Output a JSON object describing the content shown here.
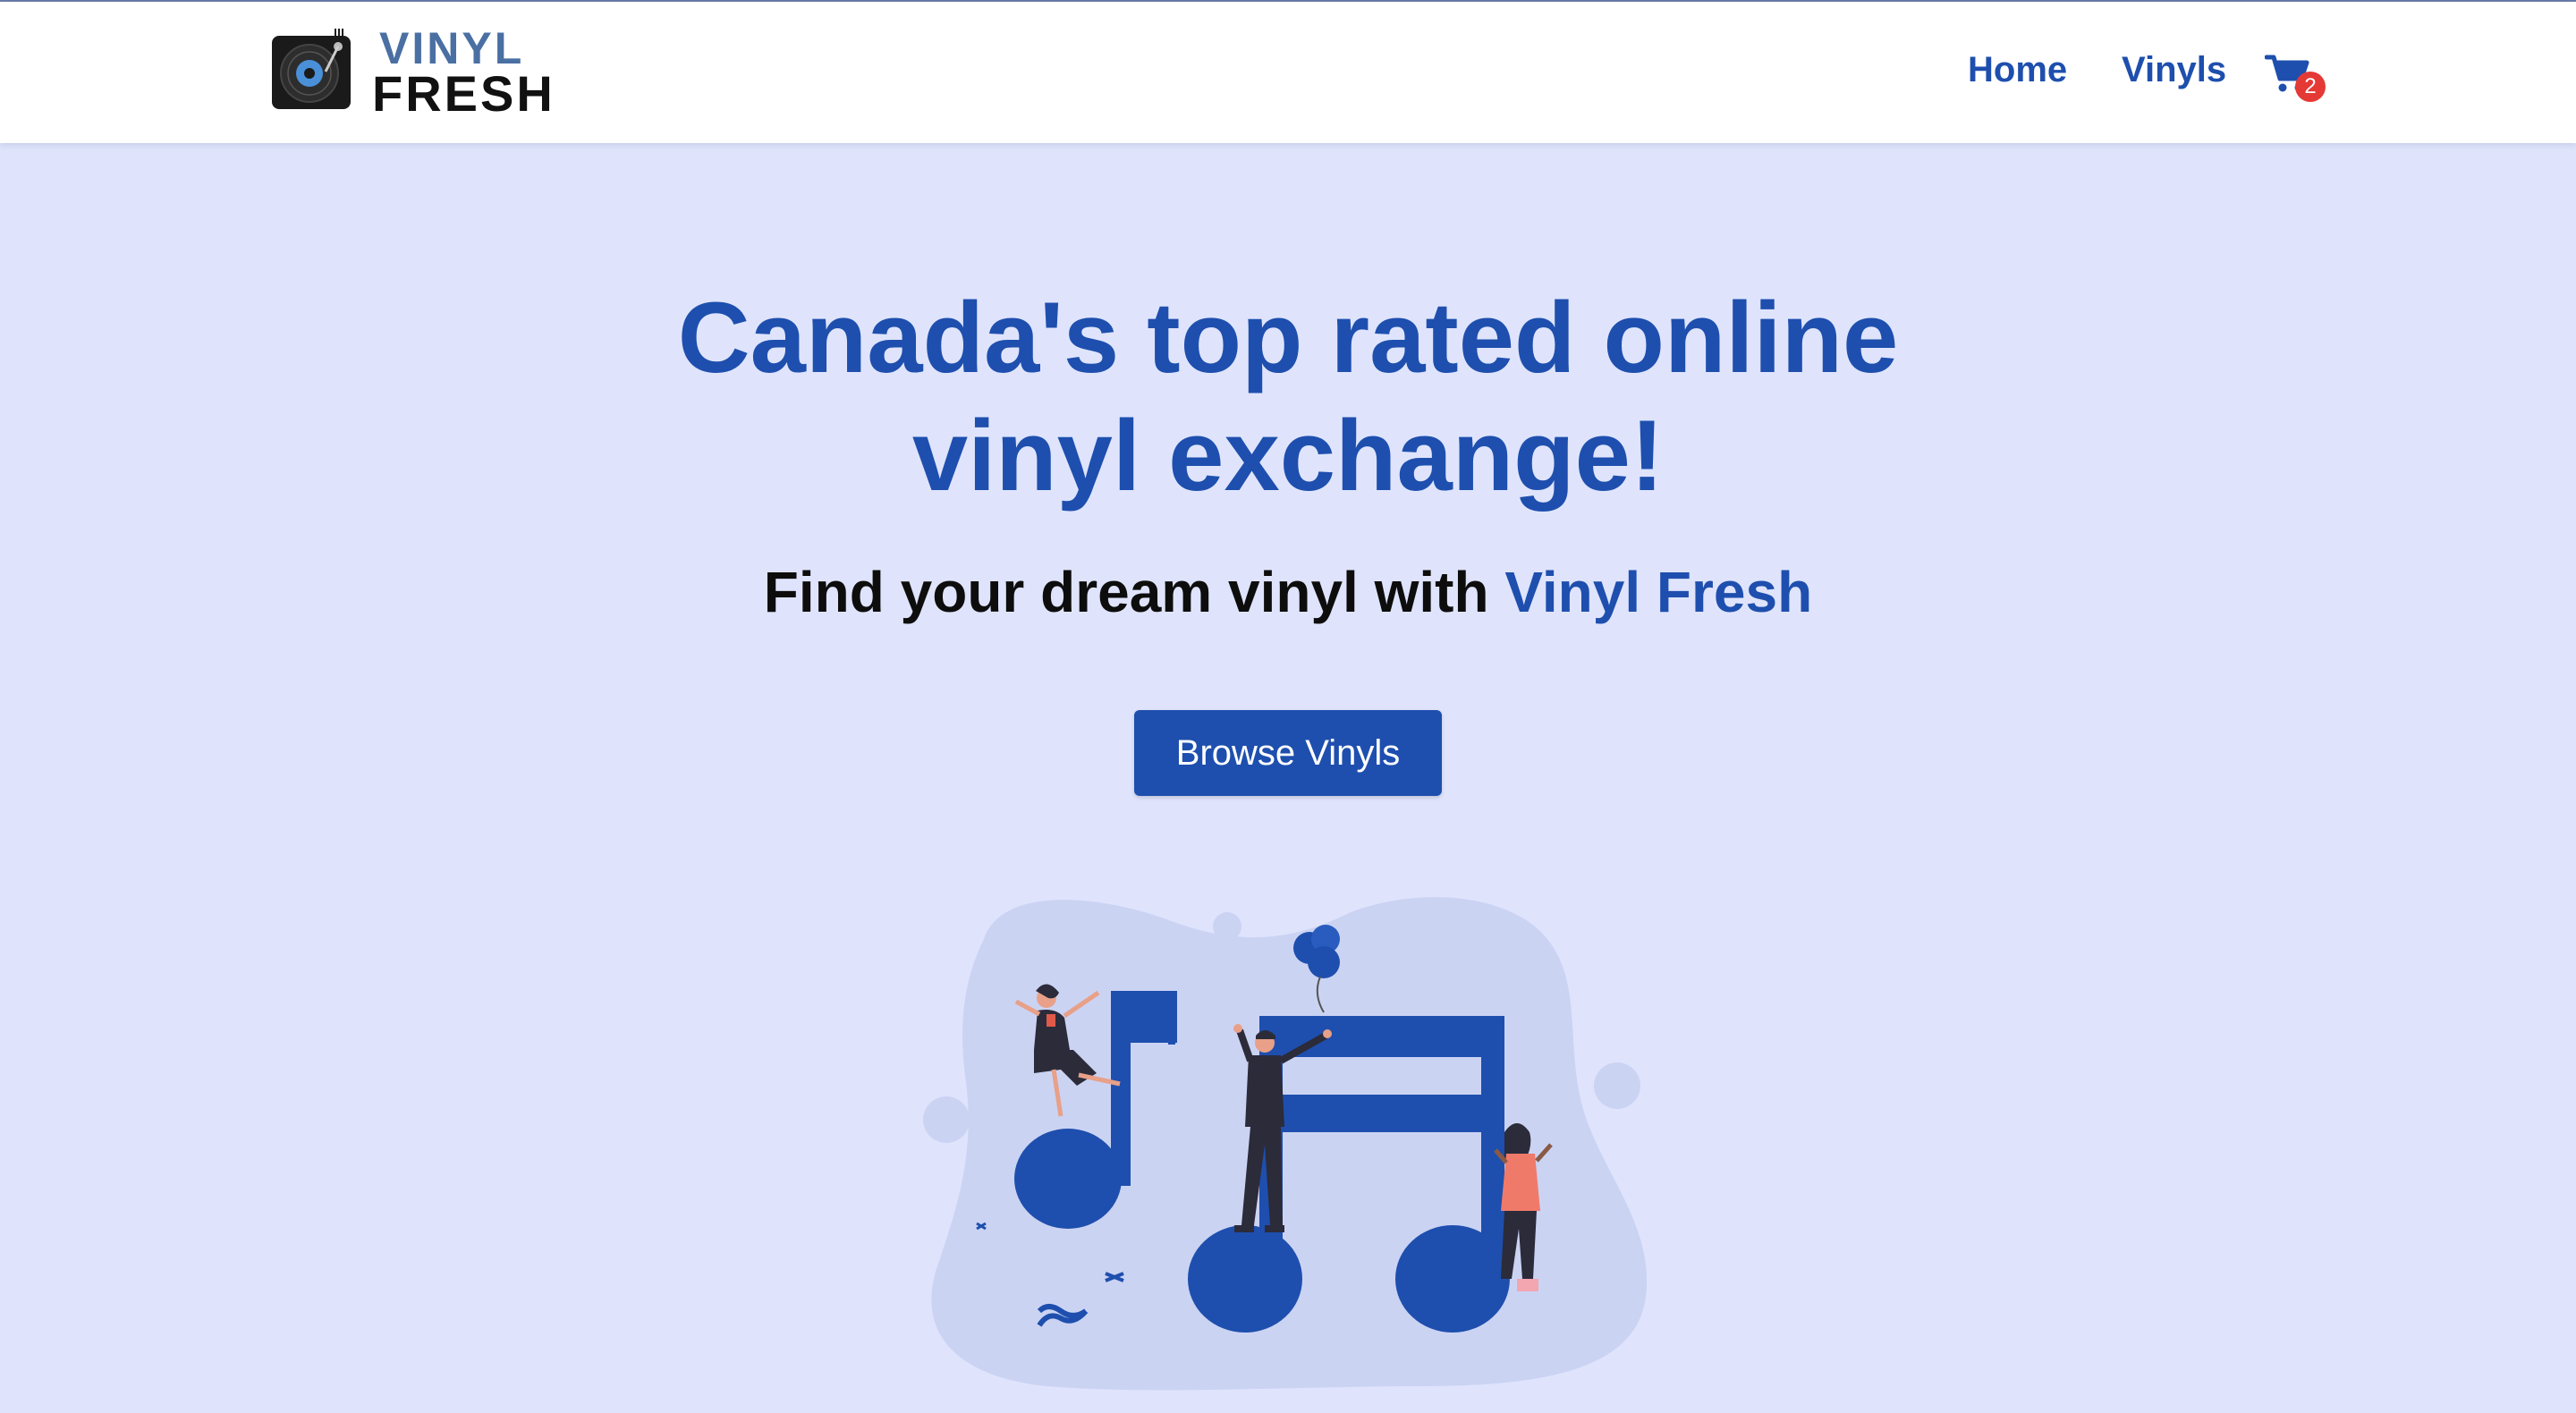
{
  "brand": {
    "logo_line1": "VINYL",
    "logo_line2": "FRESH",
    "logo_icon": "turntable-icon"
  },
  "nav": {
    "home": "Home",
    "vinyls": "Vinyls",
    "cart_icon": "shopping-cart-icon",
    "cart_count": "2"
  },
  "hero": {
    "title_line1": "Canada's top rated online",
    "title_line2": "vinyl exchange!",
    "subtitle_prefix": "Find your dream vinyl with ",
    "subtitle_brand": "Vinyl Fresh",
    "cta": "Browse Vinyls",
    "illustration": "music-notes-people-illustration"
  },
  "colors": {
    "page_bg": "#dfe4fc",
    "primary": "#1e4fae",
    "logo_blue": "#4a6fa3",
    "badge_red": "#e53935"
  }
}
